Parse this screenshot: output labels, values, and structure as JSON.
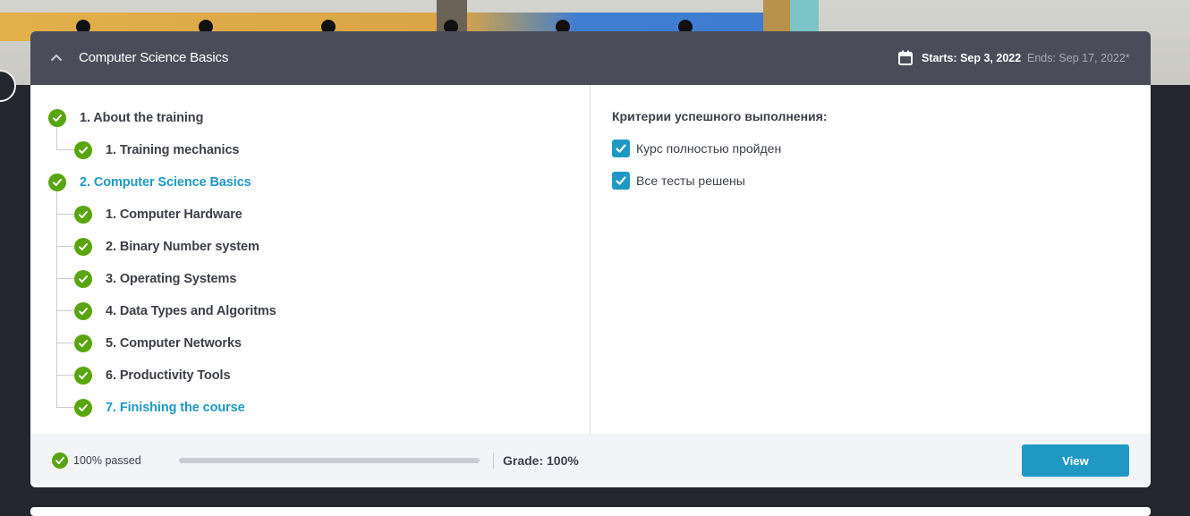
{
  "course": {
    "title": "Computer Science Basics",
    "starts": "Starts: Sep 3, 2022",
    "ends": "Ends: Sep 17, 2022*"
  },
  "tree": [
    {
      "label": "1. About the training",
      "level": 0,
      "active": false,
      "status": "completed"
    },
    {
      "label": "1. Training mechanics",
      "level": 1,
      "active": false,
      "status": "completed"
    },
    {
      "label": "2. Computer Science Basics",
      "level": 0,
      "active": true,
      "status": "completed"
    },
    {
      "label": "1. Computer Hardware",
      "level": 1,
      "active": false,
      "status": "completed"
    },
    {
      "label": "2. Binary Number system",
      "level": 1,
      "active": false,
      "status": "completed"
    },
    {
      "label": "3. Operating Systems",
      "level": 1,
      "active": false,
      "status": "completed"
    },
    {
      "label": "4. Data Types and Algoritms",
      "level": 1,
      "active": false,
      "status": "completed"
    },
    {
      "label": "5. Computer Networks",
      "level": 1,
      "active": false,
      "status": "completed"
    },
    {
      "label": "6. Productivity Tools",
      "level": 1,
      "active": false,
      "status": "completed"
    },
    {
      "label": "7. Finishing the course",
      "level": 1,
      "active": true,
      "status": "completed"
    }
  ],
  "criteria": {
    "title": "Критерии успешного выполнения:",
    "items": [
      {
        "label": "Курс полностью пройден",
        "checked": true
      },
      {
        "label": "Все тесты решены",
        "checked": true
      }
    ]
  },
  "footer": {
    "passed": "100% passed",
    "progress": 1.0,
    "grade": "Grade: 100%",
    "view_label": "View"
  },
  "colors": {
    "header_bg": "#4a4c5a",
    "accent": "#1f99c4",
    "success": "#58a50f"
  }
}
